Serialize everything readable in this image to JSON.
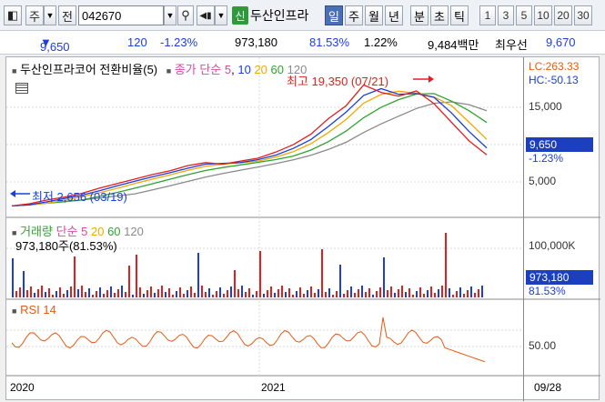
{
  "toolbar": {
    "market_label": "주",
    "kind_label": "전",
    "code_value": "042670",
    "new_badge": "신",
    "stock_name": "두산인프라",
    "periods": [
      "일",
      "주",
      "월",
      "년",
      "분",
      "초",
      "틱"
    ],
    "numbers": [
      "1",
      "3",
      "5",
      "10",
      "20",
      "30"
    ]
  },
  "quote": {
    "price": "9,650",
    "change": "120",
    "change_pct": "-1.23%",
    "volume": "973,180",
    "volume_ratio": "81.53%",
    "turnover": "1.22%",
    "amount": "9,484백만",
    "prev_label": "최우선",
    "best_price": "9,670"
  },
  "price_panel": {
    "title": "두산인프라코어 전환비율(5)",
    "ma_label": "종가 단순",
    "ma_periods": [
      "5",
      "10",
      "20",
      "60",
      "120"
    ],
    "lc": "LC:263.33",
    "hc": "HC:-50.13",
    "y_ticks": [
      "15,000",
      "10,000",
      "5,000"
    ],
    "current_price_tag": "9,650",
    "current_pct": "-1.23%",
    "high_annotation": "최고 19,350 (07/21)",
    "low_annotation": "최저 2,656 (03/19)"
  },
  "volume_panel": {
    "title": "거래량",
    "ma_label": "단순",
    "ma_periods": [
      "5",
      "20",
      "60",
      "120"
    ],
    "sub": "973,180주(81.53%)",
    "y_tick": "100,000K",
    "current_tag": "973,180",
    "current_pct": "81.53%"
  },
  "rsi_panel": {
    "title": "RSI 14",
    "y_tick": "50.00"
  },
  "x_axis": {
    "labels": [
      "2020",
      "2021"
    ],
    "end_date": "09/28"
  },
  "chart_data": {
    "type": "line",
    "price_range": [
      2656,
      19350
    ],
    "close_series": [
      2800,
      3100,
      3600,
      4000,
      4500,
      5200,
      5800,
      6400,
      7000,
      7500,
      8200,
      8600,
      8400,
      8800,
      9200,
      10000,
      11000,
      12400,
      14500,
      16200,
      19000,
      18000,
      17500,
      18200,
      16500,
      14000,
      11500,
      9650
    ]
  },
  "colors": {
    "up": "#e0201e",
    "down": "#1a3ee0",
    "ma5": "#d64aa8",
    "ma10": "#1a3ee0",
    "ma20": "#f2a900",
    "ma60": "#2fa32f",
    "ma120": "#8a8a8a"
  }
}
